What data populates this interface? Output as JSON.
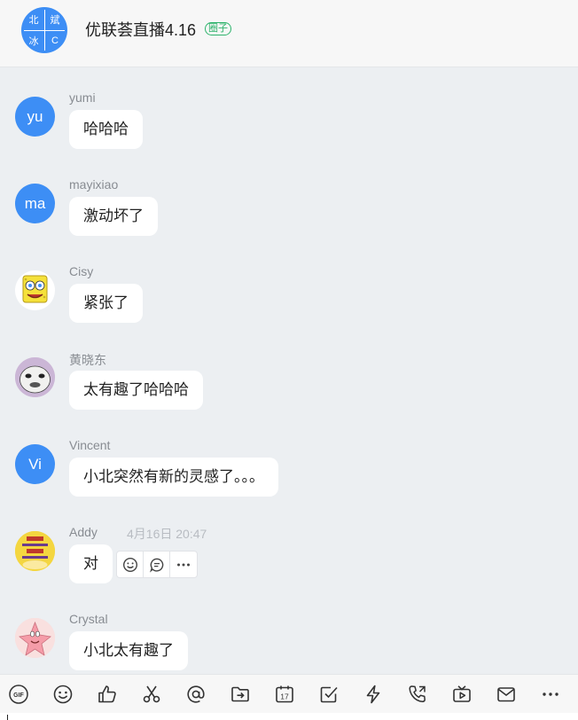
{
  "header": {
    "title": "优联荟直播4.16",
    "badge": "圈子",
    "group_avatar": [
      "北",
      "斌",
      "冰",
      "C"
    ]
  },
  "messages": [
    {
      "sender": "yumi",
      "avatar_text": "yu",
      "avatar_type": "letters",
      "text": "哈哈哈"
    },
    {
      "sender": "mayixiao",
      "avatar_text": "ma",
      "avatar_type": "letters",
      "text": "激动坏了"
    },
    {
      "sender": "Cisy",
      "avatar_text": "",
      "avatar_type": "spongebob",
      "text": "紧张了"
    },
    {
      "sender": "黄晓东",
      "avatar_text": "",
      "avatar_type": "cartoon-face",
      "text": "太有趣了哈哈哈"
    },
    {
      "sender": "Vincent",
      "avatar_text": "Vi",
      "avatar_type": "letters",
      "text": "小北突然有新的灵感了。。。"
    },
    {
      "sender": "Addy",
      "avatar_text": "",
      "avatar_type": "poster",
      "time": "4月16日 20:47",
      "text": "对",
      "actions": [
        "emoji-react-icon",
        "reply-icon",
        "more-icon"
      ]
    },
    {
      "sender": "Crystal",
      "avatar_text": "",
      "avatar_type": "patrick",
      "text": "小北太有趣了"
    }
  ],
  "toolbar": {
    "tools": [
      "gif-icon",
      "emoji-icon",
      "thumbs-up-icon",
      "scissors-icon",
      "mention-icon",
      "forward-folder-icon",
      "calendar-icon",
      "checkbox-icon",
      "lightning-icon",
      "phone-icon",
      "tv-icon",
      "mail-icon",
      "more-icon"
    ],
    "gif_label": "GIF",
    "calendar_day": "17"
  },
  "colors": {
    "accent": "#3d8ef5",
    "badge": "#2db36b",
    "background": "#eceff2"
  }
}
